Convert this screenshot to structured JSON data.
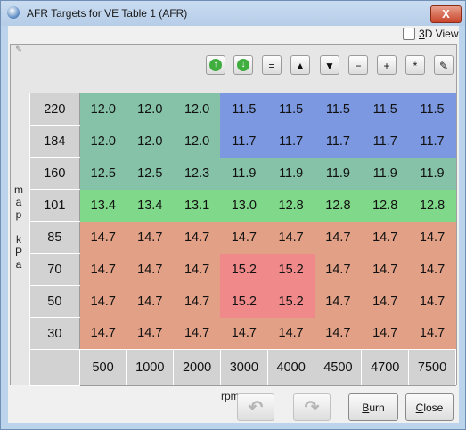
{
  "window": {
    "title": "AFR Targets for VE Table 1 (AFR)",
    "close_glyph": "X"
  },
  "view3d": {
    "prefix": "",
    "underlined": "3",
    "suffix": "D View",
    "checked": false
  },
  "toolbar": {
    "buttons": [
      {
        "icon": "up-arrow-green-icon",
        "glyph": "↑"
      },
      {
        "icon": "down-arrow-green-icon",
        "glyph": "↓"
      },
      {
        "icon": "equals-icon",
        "glyph": "="
      },
      {
        "icon": "increment-up-icon",
        "glyph": "▲"
      },
      {
        "icon": "increment-down-icon",
        "glyph": "▼"
      },
      {
        "icon": "minus-icon",
        "glyph": "−"
      },
      {
        "icon": "plus-icon",
        "glyph": "+"
      },
      {
        "icon": "multiply-icon",
        "glyph": "*"
      },
      {
        "icon": "pencil-icon",
        "glyph": "✎"
      }
    ]
  },
  "axis": {
    "y_label_chars": [
      "m",
      "a",
      "p",
      "",
      "k",
      "P",
      "a"
    ],
    "x_label": "rpm"
  },
  "table": {
    "row_headers": [
      "220",
      "184",
      "160",
      "101",
      "85",
      "70",
      "50",
      "30"
    ],
    "col_headers": [
      "500",
      "1000",
      "2000",
      "3000",
      "4000",
      "4500",
      "4700",
      "7500"
    ],
    "rows": [
      [
        "12.0",
        "12.0",
        "12.0",
        "11.5",
        "11.5",
        "11.5",
        "11.5",
        "11.5"
      ],
      [
        "12.0",
        "12.0",
        "12.0",
        "11.7",
        "11.7",
        "11.7",
        "11.7",
        "11.7"
      ],
      [
        "12.5",
        "12.5",
        "12.3",
        "11.9",
        "11.9",
        "11.9",
        "11.9",
        "11.9"
      ],
      [
        "13.4",
        "13.4",
        "13.1",
        "13.0",
        "12.8",
        "12.8",
        "12.8",
        "12.8"
      ],
      [
        "14.7",
        "14.7",
        "14.7",
        "14.7",
        "14.7",
        "14.7",
        "14.7",
        "14.7"
      ],
      [
        "14.7",
        "14.7",
        "14.7",
        "15.2",
        "15.2",
        "14.7",
        "14.7",
        "14.7"
      ],
      [
        "14.7",
        "14.7",
        "14.7",
        "15.2",
        "15.2",
        "14.7",
        "14.7",
        "14.7"
      ],
      [
        "14.7",
        "14.7",
        "14.7",
        "14.7",
        "14.7",
        "14.7",
        "14.7",
        "14.7"
      ]
    ],
    "colors": {
      "rich_low": "#7b98e0",
      "rich_mid": "#7f9ae6",
      "lean_bluegray": "#8aa7d3",
      "teal": "#85c2a8",
      "green": "#80d98a",
      "stoich": "#e2a186",
      "lean": "#f08a8a"
    }
  },
  "footer": {
    "undo_icon": "undo-icon",
    "redo_icon": "redo-icon",
    "burn_label_u": "B",
    "burn_label_rest": "urn",
    "close_label_u": "C",
    "close_label_rest": "lose"
  }
}
